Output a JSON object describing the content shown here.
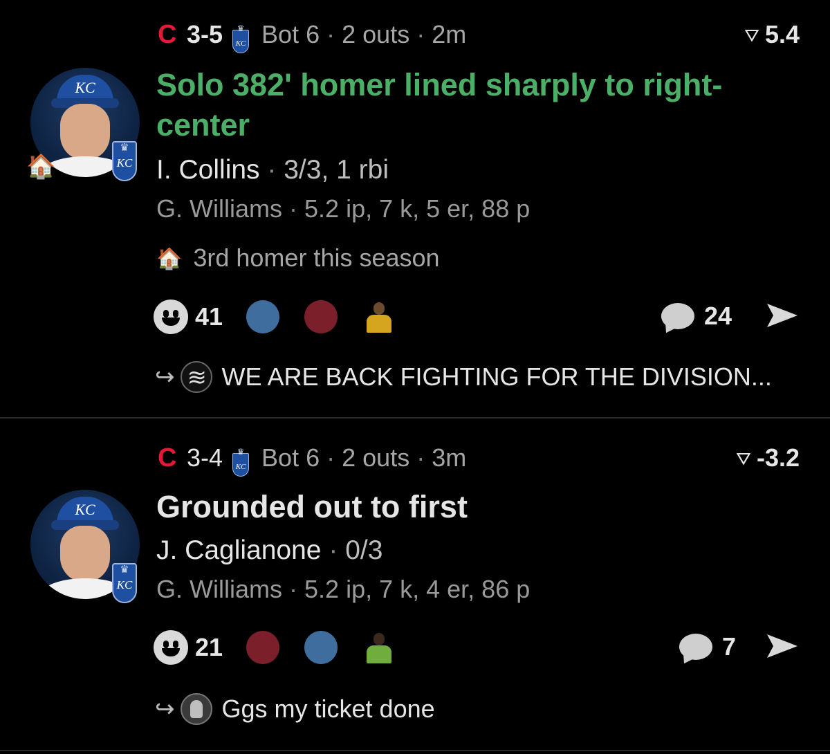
{
  "posts": [
    {
      "team_logo_away": "C",
      "score": "3-5",
      "team_logo_home": "KC",
      "inning": "Bot 6",
      "outs": "2 outs",
      "time": "2m",
      "win_prob_icon": "⛛",
      "win_prob": "5.4",
      "headline": "Solo 382' homer lined sharply to right-center",
      "headline_color": "#4caf68",
      "batter_name": "I. Collins",
      "batter_stat": "3/3, 1 rbi",
      "pitcher_name": "G. Williams",
      "pitcher_stat": "5.2 ip, 7 k, 5 er, 88 p",
      "avatar_cap_logo": "KC",
      "badge_text": "KC",
      "home_icon": "🏠",
      "note_icon": "🏠",
      "note": "3rd homer this season",
      "reaction_count": "41",
      "comment_count": "24",
      "reply_arrow": "↪",
      "reply_text": "WE ARE BACK FIGHTING FOR THE DIVISION..."
    },
    {
      "team_logo_away": "C",
      "score": "3-4",
      "team_logo_home": "KC",
      "inning": "Bot 6",
      "outs": "2 outs",
      "time": "3m",
      "win_prob_icon": "⛛",
      "win_prob": "-3.2",
      "headline": "Grounded out to first",
      "headline_color": "#e6e6e6",
      "batter_name": "J. Caglianone",
      "batter_stat": "0/3",
      "pitcher_name": "G. Williams",
      "pitcher_stat": "5.2 ip, 7 k, 4 er, 86 p",
      "avatar_cap_logo": "KC",
      "badge_text": "KC",
      "reaction_count": "21",
      "comment_count": "7",
      "reply_arrow": "↪",
      "reply_text": "Ggs my ticket done"
    }
  ],
  "separator": "·",
  "colors": {
    "background": "#000000",
    "homer_green": "#4caf68",
    "guardians_red": "#e31937",
    "royals_blue": "#1f4fa0",
    "reaction_blue": "#3f6e9e",
    "reaction_red": "#7b1f2b"
  }
}
